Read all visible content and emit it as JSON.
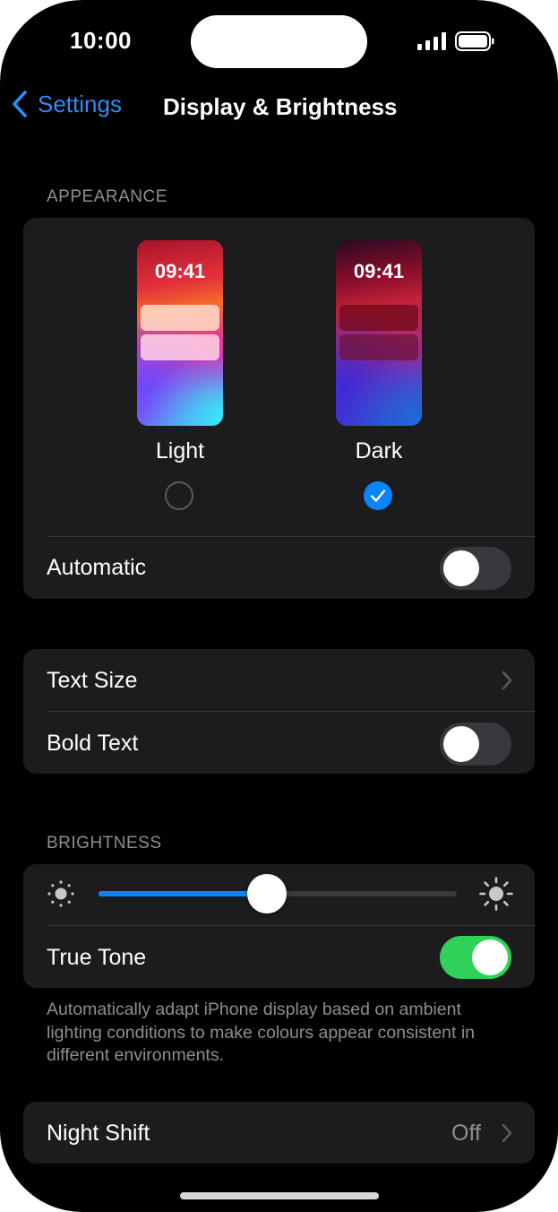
{
  "status_bar": {
    "time": "10:00"
  },
  "nav": {
    "back_label": "Settings",
    "title": "Display & Brightness"
  },
  "appearance": {
    "section_label": "APPEARANCE",
    "options": [
      {
        "name": "Light",
        "preview_time": "09:41",
        "selected": false
      },
      {
        "name": "Dark",
        "preview_time": "09:41",
        "selected": true
      }
    ],
    "automatic": {
      "label": "Automatic",
      "on": false
    }
  },
  "text": {
    "text_size": {
      "label": "Text Size"
    },
    "bold_text": {
      "label": "Bold Text",
      "on": false
    }
  },
  "brightness": {
    "section_label": "BRIGHTNESS",
    "level": 0.47,
    "true_tone": {
      "label": "True Tone",
      "on": true
    },
    "footnote": "Automatically adapt iPhone display based on ambient lighting conditions to make colours appear consistent in different environments."
  },
  "night_shift": {
    "label": "Night Shift",
    "value": "Off"
  },
  "colors": {
    "accent": "#0a84ff",
    "toggle_on": "#30d158",
    "back_link": "#2f8bf5"
  }
}
